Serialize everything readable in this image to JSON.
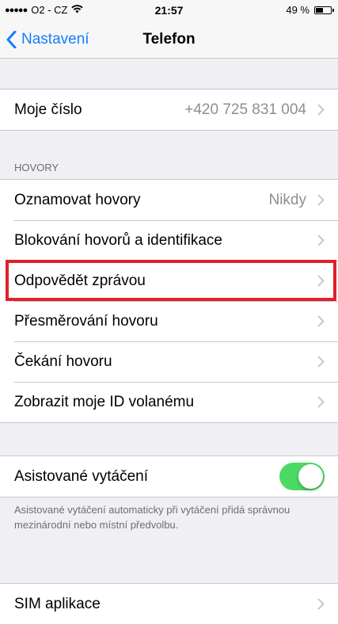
{
  "status_bar": {
    "signal_dots": "●●●●●",
    "carrier": "O2 - CZ",
    "time": "21:57",
    "battery_percent": "49 %",
    "battery_level": 0.49
  },
  "nav": {
    "back_label": "Nastavení",
    "title": "Telefon"
  },
  "my_number": {
    "label": "Moje číslo",
    "value": "+420 725 831 004"
  },
  "calls_section": {
    "header": "HOVORY",
    "items": [
      {
        "label": "Oznamovat hovory",
        "value": "Nikdy"
      },
      {
        "label": "Blokování hovorů a identifikace",
        "value": ""
      },
      {
        "label": "Odpovědět zprávou",
        "value": ""
      },
      {
        "label": "Přesměrování hovoru",
        "value": ""
      },
      {
        "label": "Čekání hovoru",
        "value": ""
      },
      {
        "label": "Zobrazit moje ID volanému",
        "value": ""
      }
    ]
  },
  "assisted_dialing": {
    "label": "Asistované vytáčení",
    "enabled": true,
    "footer": "Asistované vytáčení automaticky při vytáčení přidá správnou mezinárodní nebo místní předvolbu."
  },
  "sim": {
    "label": "SIM aplikace"
  },
  "colors": {
    "accent": "#157efb",
    "toggle_on": "#4cd964",
    "highlight": "#e0202a"
  }
}
